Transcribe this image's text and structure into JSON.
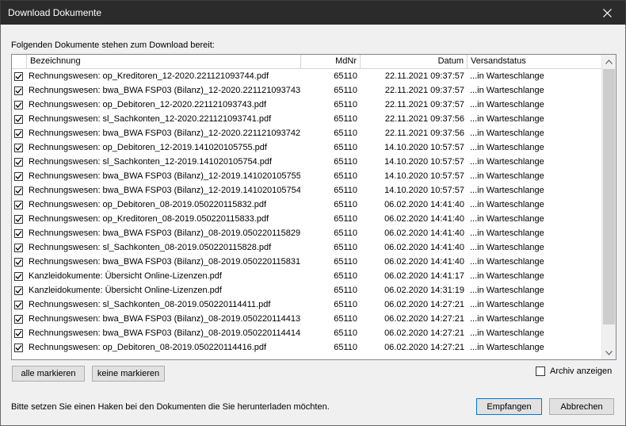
{
  "window": {
    "title": "Download Dokumente"
  },
  "intro_text": "Folgenden Dokumente stehen zum Download bereit:",
  "columns": {
    "name": "Bezeichnung",
    "mdnr": "MdNr",
    "datum": "Datum",
    "status": "Versandstatus"
  },
  "rows": [
    {
      "name": "Rechnungswesen: op_Kreditoren_12-2020.221121093744.pdf",
      "mdnr": "65110",
      "datum": "22.11.2021 09:37:57",
      "status": "...in Warteschlange"
    },
    {
      "name": "Rechnungswesen: bwa_BWA FSP03 (Bilanz)_12-2020.221121093743",
      "mdnr": "65110",
      "datum": "22.11.2021 09:37:57",
      "status": "...in Warteschlange"
    },
    {
      "name": "Rechnungswesen: op_Debitoren_12-2020.221121093743.pdf",
      "mdnr": "65110",
      "datum": "22.11.2021 09:37:57",
      "status": "...in Warteschlange"
    },
    {
      "name": "Rechnungswesen: sl_Sachkonten_12-2020.221121093741.pdf",
      "mdnr": "65110",
      "datum": "22.11.2021 09:37:56",
      "status": "...in Warteschlange"
    },
    {
      "name": "Rechnungswesen: bwa_BWA FSP03 (Bilanz)_12-2020.221121093742",
      "mdnr": "65110",
      "datum": "22.11.2021 09:37:56",
      "status": "...in Warteschlange"
    },
    {
      "name": "Rechnungswesen: op_Debitoren_12-2019.141020105755.pdf",
      "mdnr": "65110",
      "datum": "14.10.2020 10:57:57",
      "status": "...in Warteschlange"
    },
    {
      "name": "Rechnungswesen: sl_Sachkonten_12-2019.141020105754.pdf",
      "mdnr": "65110",
      "datum": "14.10.2020 10:57:57",
      "status": "...in Warteschlange"
    },
    {
      "name": "Rechnungswesen: bwa_BWA FSP03 (Bilanz)_12-2019.141020105755",
      "mdnr": "65110",
      "datum": "14.10.2020 10:57:57",
      "status": "...in Warteschlange"
    },
    {
      "name": "Rechnungswesen: bwa_BWA FSP03 (Bilanz)_12-2019.141020105754",
      "mdnr": "65110",
      "datum": "14.10.2020 10:57:57",
      "status": "...in Warteschlange"
    },
    {
      "name": "Rechnungswesen: op_Debitoren_08-2019.050220115832.pdf",
      "mdnr": "65110",
      "datum": "06.02.2020 14:41:40",
      "status": "...in Warteschlange"
    },
    {
      "name": "Rechnungswesen: op_Kreditoren_08-2019.050220115833.pdf",
      "mdnr": "65110",
      "datum": "06.02.2020 14:41:40",
      "status": "...in Warteschlange"
    },
    {
      "name": "Rechnungswesen: bwa_BWA FSP03 (Bilanz)_08-2019.050220115829",
      "mdnr": "65110",
      "datum": "06.02.2020 14:41:40",
      "status": "...in Warteschlange"
    },
    {
      "name": "Rechnungswesen: sl_Sachkonten_08-2019.050220115828.pdf",
      "mdnr": "65110",
      "datum": "06.02.2020 14:41:40",
      "status": "...in Warteschlange"
    },
    {
      "name": "Rechnungswesen: bwa_BWA FSP03 (Bilanz)_08-2019.050220115831",
      "mdnr": "65110",
      "datum": "06.02.2020 14:41:40",
      "status": "...in Warteschlange"
    },
    {
      "name": "Kanzleidokumente: Übersicht Online-Lizenzen.pdf",
      "mdnr": "65110",
      "datum": "06.02.2020 14:41:17",
      "status": "...in Warteschlange"
    },
    {
      "name": "Kanzleidokumente: Übersicht Online-Lizenzen.pdf",
      "mdnr": "65110",
      "datum": "06.02.2020 14:31:19",
      "status": "...in Warteschlange"
    },
    {
      "name": "Rechnungswesen: sl_Sachkonten_08-2019.050220114411.pdf",
      "mdnr": "65110",
      "datum": "06.02.2020 14:27:21",
      "status": "...in Warteschlange"
    },
    {
      "name": "Rechnungswesen: bwa_BWA FSP03 (Bilanz)_08-2019.050220114413",
      "mdnr": "65110",
      "datum": "06.02.2020 14:27:21",
      "status": "...in Warteschlange"
    },
    {
      "name": "Rechnungswesen: bwa_BWA FSP03 (Bilanz)_08-2019.050220114414",
      "mdnr": "65110",
      "datum": "06.02.2020 14:27:21",
      "status": "...in Warteschlange"
    },
    {
      "name": "Rechnungswesen: op_Debitoren_08-2019.050220114416.pdf",
      "mdnr": "65110",
      "datum": "06.02.2020 14:27:21",
      "status": "...in Warteschlange"
    }
  ],
  "buttons": {
    "select_all": "alle markieren",
    "select_none": "keine markieren",
    "receive": "Empfangen",
    "cancel": "Abbrechen"
  },
  "archive": {
    "label": "Archiv anzeigen",
    "checked": false
  },
  "hint_text": "Bitte setzen Sie einen Haken bei den Dokumenten die Sie herunterladen möchten.",
  "colors": {
    "titlebar": "#2b2b2b",
    "default_button_border": "#0078d7",
    "scroll_thumb": "#cdcdcd"
  },
  "icons": {
    "close": "close-icon",
    "check": "checkmark-icon",
    "scroll_up": "chevron-up-icon",
    "scroll_down": "chevron-down-icon"
  }
}
